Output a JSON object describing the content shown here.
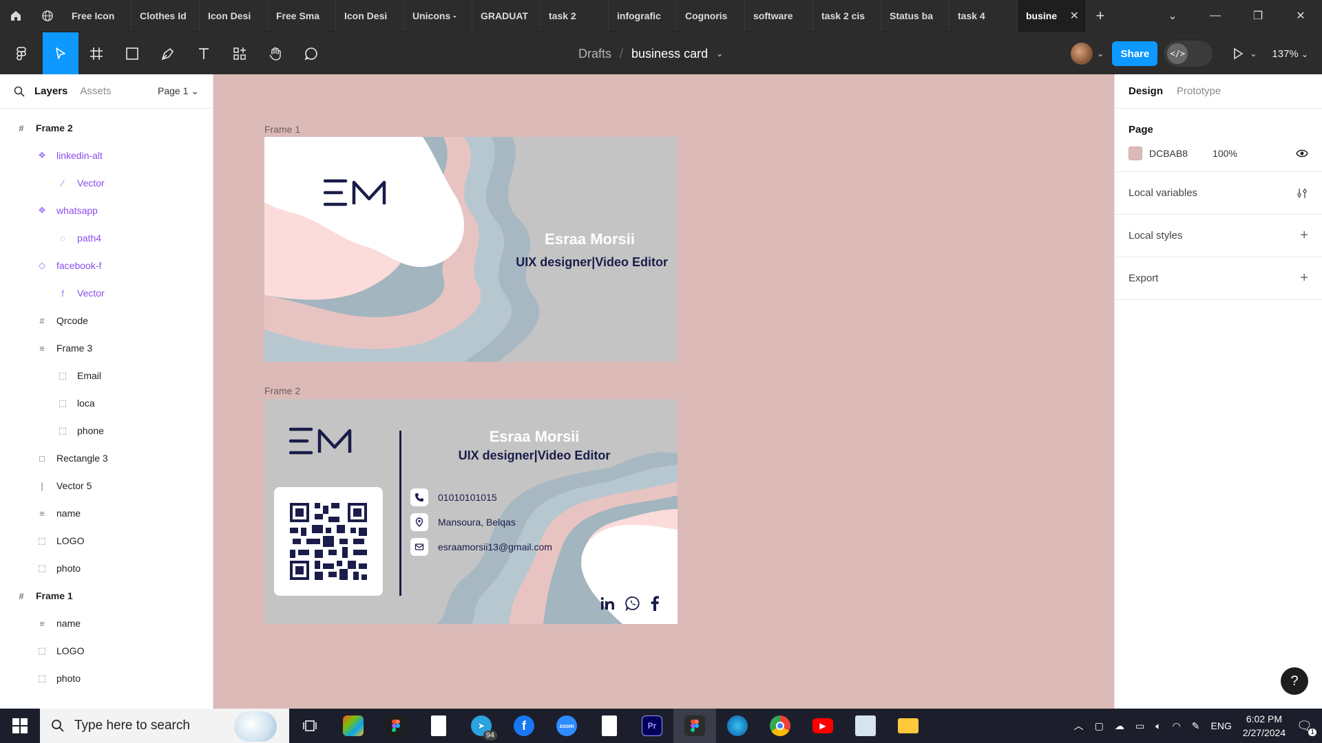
{
  "tabs": [
    {
      "label": "Free Icon"
    },
    {
      "label": "Clothes Id"
    },
    {
      "label": "Icon Desi"
    },
    {
      "label": "Free Sma"
    },
    {
      "label": "Icon Desi"
    },
    {
      "label": "Unicons -"
    },
    {
      "label": "GRADUAT"
    },
    {
      "label": "task 2"
    },
    {
      "label": "infografic"
    },
    {
      "label": "Cognoris"
    },
    {
      "label": "software"
    },
    {
      "label": "task 2 cis"
    },
    {
      "label": "Status ba"
    },
    {
      "label": "task 4"
    }
  ],
  "active_tab": {
    "label": "busine",
    "close": "✕"
  },
  "add_tab": "+",
  "breadcrumb": {
    "root": "Drafts",
    "separator": "/",
    "file": "business card",
    "chevron": "⌄"
  },
  "toolbar": {
    "share_label": "Share",
    "devmode_label": "</>",
    "zoom": "137%"
  },
  "left_panel": {
    "layers_tab": "Layers",
    "assets_tab": "Assets",
    "page": "Page 1 ⌄",
    "layers": [
      {
        "label": "Frame 2",
        "icon": "#",
        "indent": 0,
        "kind": "top"
      },
      {
        "label": "linkedin-alt",
        "icon": "❖",
        "indent": 1,
        "kind": "comp"
      },
      {
        "label": "Vector",
        "icon": "⁄",
        "indent": 2,
        "kind": "comp"
      },
      {
        "label": "whatsapp",
        "icon": "❖",
        "indent": 1,
        "kind": "comp"
      },
      {
        "label": "path4",
        "icon": "◌",
        "indent": 2,
        "kind": "comp"
      },
      {
        "label": "facebook-f",
        "icon": "◇",
        "indent": 1,
        "kind": "comp"
      },
      {
        "label": "Vector",
        "icon": "f",
        "indent": 2,
        "kind": "comp"
      },
      {
        "label": "Qrcode",
        "icon": "#",
        "indent": 1,
        "kind": "normal"
      },
      {
        "label": "Frame 3",
        "icon": "≡",
        "indent": 1,
        "kind": "normal"
      },
      {
        "label": "Email",
        "icon": "⬚",
        "indent": 2,
        "kind": "normal"
      },
      {
        "label": "loca",
        "icon": "⬚",
        "indent": 2,
        "kind": "normal"
      },
      {
        "label": "phone",
        "icon": "⬚",
        "indent": 2,
        "kind": "normal"
      },
      {
        "label": "Rectangle 3",
        "icon": "□",
        "indent": 1,
        "kind": "normal"
      },
      {
        "label": "Vector 5",
        "icon": "|",
        "indent": 1,
        "kind": "normal"
      },
      {
        "label": "name",
        "icon": "≡",
        "indent": 1,
        "kind": "normal"
      },
      {
        "label": "LOGO",
        "icon": "⬚",
        "indent": 1,
        "kind": "normal"
      },
      {
        "label": "photo",
        "icon": "⬚",
        "indent": 1,
        "kind": "normal"
      },
      {
        "label": "Frame 1",
        "icon": "#",
        "indent": 0,
        "kind": "top"
      },
      {
        "label": "name",
        "icon": "≡",
        "indent": 1,
        "kind": "normal"
      },
      {
        "label": "LOGO",
        "icon": "⬚",
        "indent": 1,
        "kind": "normal"
      },
      {
        "label": "photo",
        "icon": "⬚",
        "indent": 1,
        "kind": "normal"
      }
    ]
  },
  "canvas": {
    "background": "#DCBAB8",
    "frame1": {
      "label": "Frame 1",
      "logo": "EM",
      "name": "Esraa Morsii",
      "role": "UIX designer|Video Editor"
    },
    "frame2": {
      "label": "Frame 2",
      "logo": "EM",
      "name": "Esraa Morsii",
      "role": "UIX designer|Video Editor",
      "phone": "01010101015",
      "location": "Mansoura, Belqas",
      "email": "esraamorsii13@gmail.com"
    }
  },
  "right_panel": {
    "design_tab": "Design",
    "prototype_tab": "Prototype",
    "page_title": "Page",
    "page_color": "DCBAB8",
    "page_opacity": "100%",
    "local_variables": "Local variables",
    "local_styles": "Local styles",
    "export": "Export",
    "help": "?"
  },
  "taskbar": {
    "search_placeholder": "Type here to search",
    "telegram_badge": "94",
    "language": "ENG",
    "time": "6:02 PM",
    "date": "2/27/2024",
    "notifications": "1"
  }
}
